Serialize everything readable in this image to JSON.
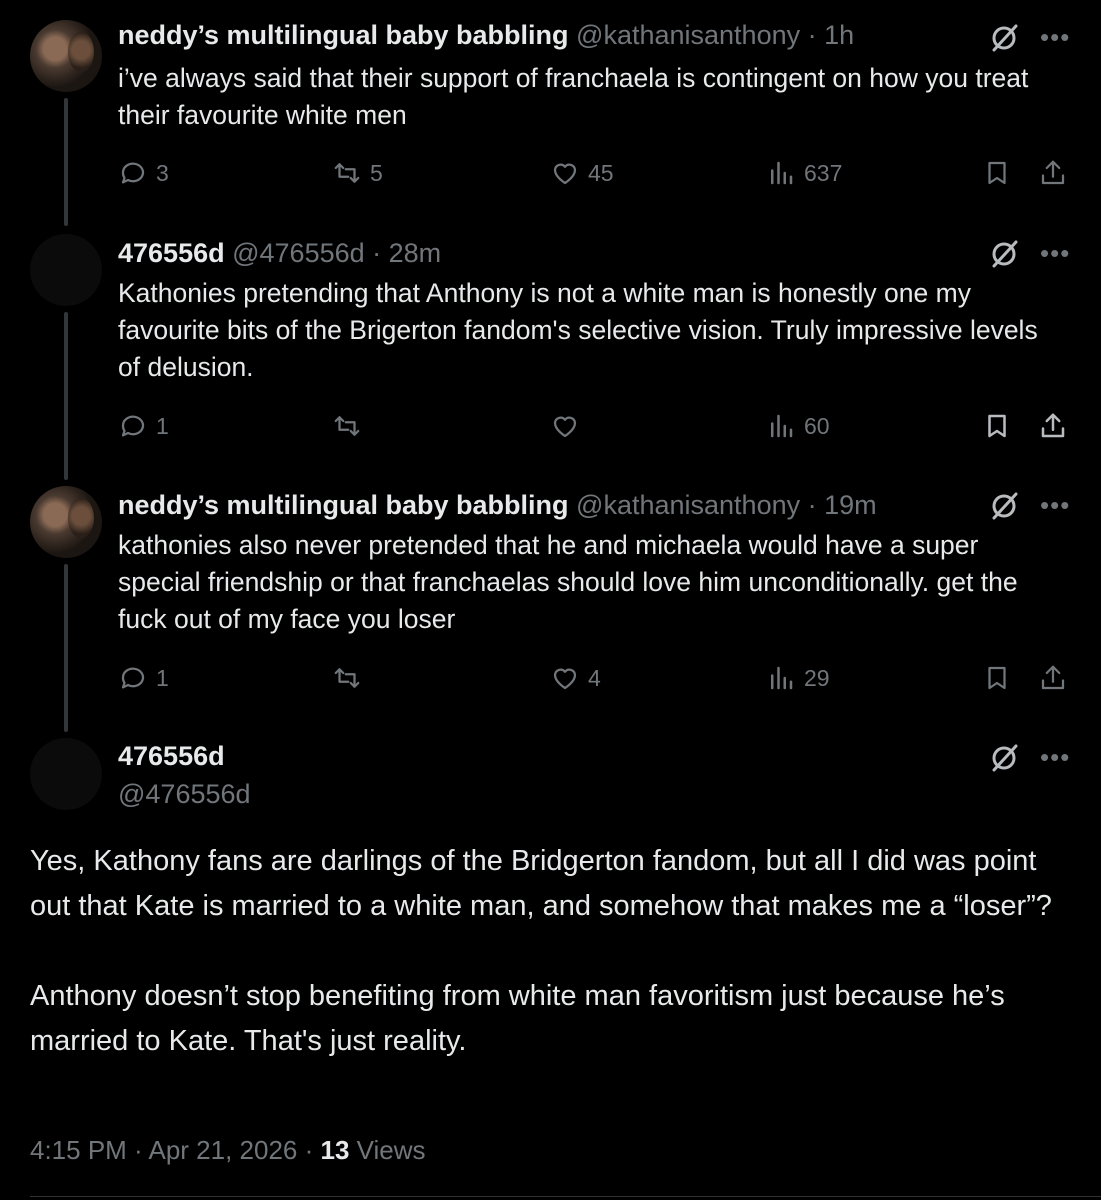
{
  "tweets": [
    {
      "name": "neddy’s multilingual baby babbling",
      "handle": "@kathanisanthony",
      "time": "· 1h",
      "text": "i’ve always said that their support of franchaela is contingent on how you treat their favourite white men",
      "replies": "3",
      "reposts": "5",
      "likes": "45",
      "views": "637"
    },
    {
      "name": "476556d",
      "handle": "@476556d",
      "time": "· 28m",
      "text": "Kathonies pretending that Anthony is not a white man is honestly one my favourite bits of the Brigerton fandom's selective vision. Truly impressive levels of delusion.",
      "replies": "1",
      "reposts": "",
      "likes": "",
      "views": "60"
    },
    {
      "name": "neddy’s multilingual baby babbling",
      "handle": "@kathanisanthony",
      "time": "· 19m",
      "text": "kathonies also never pretended that he and michaela would have a super special friendship or that franchaelas should love him unconditionally. get the fuck out of my face you loser",
      "replies": "1",
      "reposts": "",
      "likes": "4",
      "views": "29"
    }
  ],
  "main": {
    "name": "476556d",
    "handle": "@476556d",
    "paragraph1": "Yes, Kathony fans are darlings of the Bridgerton fandom, but all I did was point out that Kate is married to a white man, and somehow that makes me a “loser”?",
    "paragraph2": "Anthony doesn’t stop benefiting from white man favoritism just because he’s married to Kate. That's just reality.",
    "time": "4:15 PM · Apr 21, 2026 · ",
    "views_count": "13",
    "views_label": " Views"
  },
  "icons": {
    "reply": "reply-icon",
    "repost": "repost-icon",
    "like": "heart-icon",
    "views": "views-chart-icon",
    "bookmark": "bookmark-icon",
    "share": "share-icon",
    "grok": "grok-icon",
    "more": "more-icon"
  },
  "colors": {
    "background": "#000000",
    "text": "#e7e9ea",
    "muted": "#71767b",
    "thread_line": "#333639"
  }
}
